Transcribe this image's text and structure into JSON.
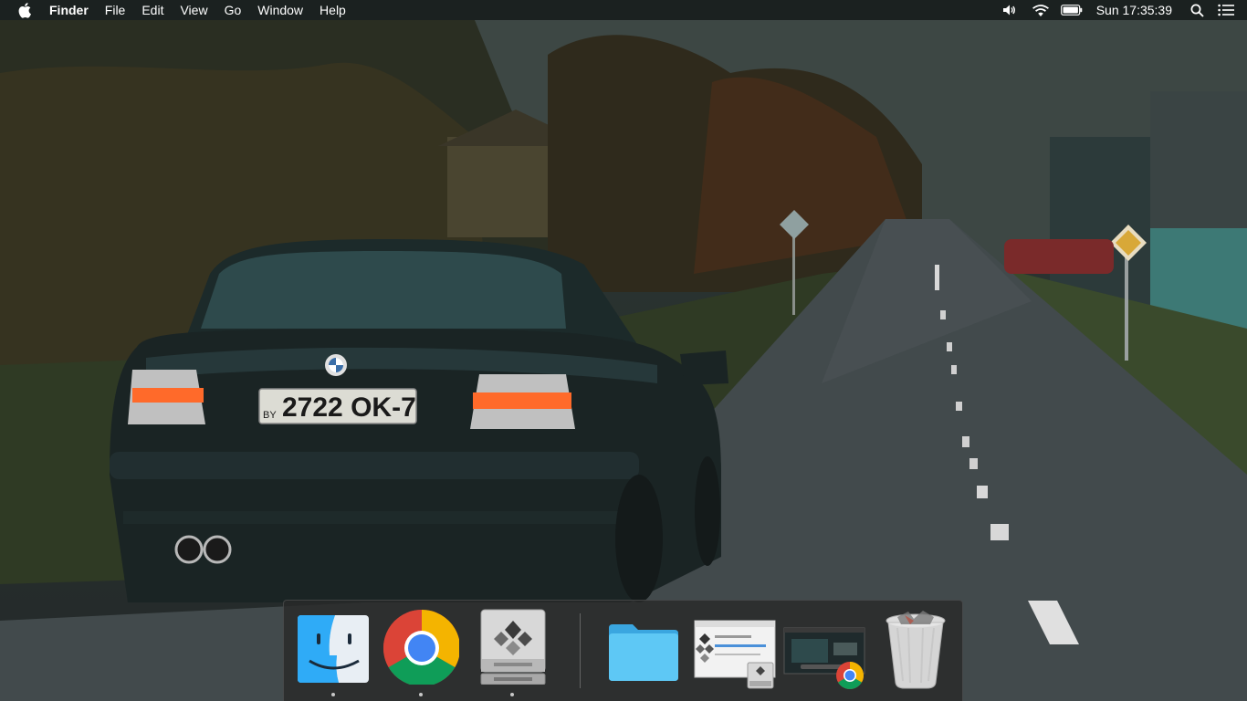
{
  "menubar": {
    "apple_icon": "apple-logo-icon",
    "app_name": "Finder",
    "menus": [
      "File",
      "Edit",
      "View",
      "Go",
      "Window",
      "Help"
    ],
    "status": {
      "volume_icon": "volume-icon",
      "wifi_icon": "wifi-icon",
      "battery_icon": "battery-icon",
      "clock": "Sun 17:35:39",
      "spotlight_icon": "spotlight-search-icon",
      "notification_icon": "notification-center-icon"
    }
  },
  "wallpaper": {
    "description_icon": "car-on-road-wallpaper",
    "license_plate": "2722 OK-7",
    "plate_country": "BY"
  },
  "dock": {
    "apps": [
      {
        "name": "Finder",
        "icon": "finder-icon",
        "running": true
      },
      {
        "name": "Google Chrome",
        "icon": "chrome-icon",
        "running": true
      },
      {
        "name": "Boot Camp Assistant",
        "icon": "bootcamp-icon",
        "running": true
      }
    ],
    "others": [
      {
        "name": "Folder",
        "icon": "folder-icon"
      },
      {
        "name": "Boot Camp Assistant window",
        "icon": "bootcamp-window-thumbnail-icon"
      },
      {
        "name": "Chrome window",
        "icon": "chrome-window-thumbnail-icon"
      },
      {
        "name": "Trash",
        "icon": "trash-icon"
      }
    ]
  },
  "colors": {
    "menubar_bg": "#141818",
    "dock_bg": "#282a2a",
    "folder_blue": "#5ec8f5"
  }
}
